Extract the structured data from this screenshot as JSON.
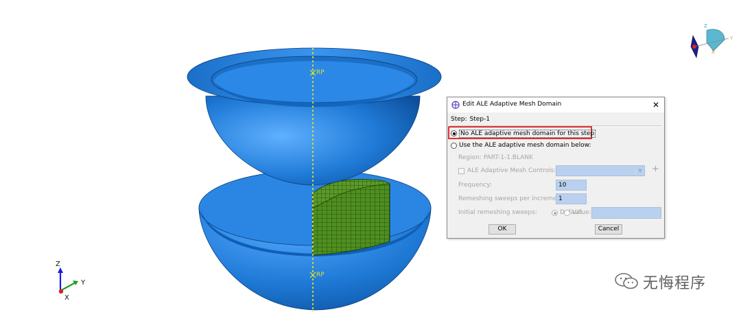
{
  "viewport": {
    "reference_point_label": "RP",
    "triad": {
      "z": "Z",
      "y": "Y",
      "x": "X"
    },
    "mini_triad": {
      "z": "Z",
      "y": "Y",
      "x": "X"
    }
  },
  "dialog": {
    "title": "Edit ALE Adaptive Mesh Domain",
    "step_label": "Step:",
    "step_value": "Step-1",
    "option_none": "No ALE adaptive mesh domain for this step",
    "option_use": "Use the ALE adaptive mesh domain below:",
    "region_label": "Region:",
    "region_value": "PART-1-1.BLANK",
    "ale_controls_label": "ALE Adaptive Mesh Controls:",
    "frequency_label": "Frequency:",
    "frequency_value": "10",
    "remeshing_sweeps_label": "Remeshing sweeps per increment:",
    "remeshing_sweeps_value": "1",
    "initial_sweeps_label": "Initial remeshing sweeps:",
    "default_label": "Default",
    "value_label": "Value:",
    "ok_label": "OK",
    "cancel_label": "Cancel",
    "close_glyph": "✕",
    "plus_glyph": "+",
    "selected_option": "none"
  },
  "watermark": {
    "text": "无悔程序"
  },
  "colors": {
    "part_blue": "#1f7ad6",
    "mesh_green": "#4c8c1e",
    "highlight_red": "#e03030",
    "disabled_field": "#b9d1ee"
  }
}
